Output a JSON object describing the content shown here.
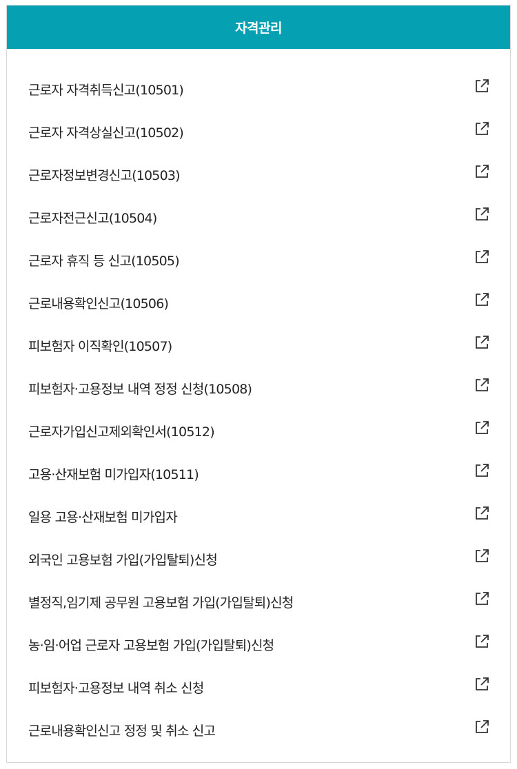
{
  "header": {
    "title": "자격관리"
  },
  "icon": "external-link-icon",
  "colors": {
    "header_bg": "#05a1b3",
    "header_text": "#ffffff",
    "item_text": "#222222"
  },
  "items": [
    {
      "label": "근로자 자격취득신고(10501)"
    },
    {
      "label": "근로자 자격상실신고(10502)"
    },
    {
      "label": "근로자정보변경신고(10503)"
    },
    {
      "label": "근로자전근신고(10504)"
    },
    {
      "label": "근로자 휴직 등 신고(10505)"
    },
    {
      "label": "근로내용확인신고(10506)"
    },
    {
      "label": "피보험자 이직확인(10507)"
    },
    {
      "label": "피보험자·고용정보 내역 정정 신청(10508)"
    },
    {
      "label": "근로자가입신고제외확인서(10512)"
    },
    {
      "label": "고용·산재보험 미가입자(10511)"
    },
    {
      "label": "일용 고용·산재보험 미가입자"
    },
    {
      "label": "외국인 고용보험 가입(가입탈퇴)신청"
    },
    {
      "label": "별정직,임기제 공무원 고용보험 가입(가입탈퇴)신청"
    },
    {
      "label": "농·임·어업 근로자 고용보험 가입(가입탈퇴)신청"
    },
    {
      "label": "피보험자·고용정보 내역 취소 신청"
    },
    {
      "label": "근로내용확인신고 정정 및 취소 신고"
    }
  ]
}
